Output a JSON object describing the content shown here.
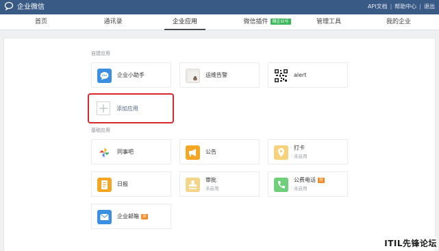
{
  "topbar": {
    "logo_text": "企业微信",
    "links": [
      "API文档",
      "帮助中心",
      "退出"
    ],
    "separator": "|",
    "bg_color": "#3a5a86"
  },
  "nav": {
    "items": [
      {
        "label": "首页"
      },
      {
        "label": "通讯录"
      },
      {
        "label": "企业应用",
        "active": true
      },
      {
        "label": "微信插件",
        "badge": "随企业号"
      },
      {
        "label": "管理工具"
      },
      {
        "label": "我的企业"
      }
    ]
  },
  "sections": {
    "custom_label": "自建应用",
    "basic_label": "基础应用"
  },
  "custom_apps": [
    {
      "name": "企业小助手",
      "icon": "chat-bubble-icon"
    },
    {
      "name": "运维告警",
      "icon": "photo-thumbnail-icon"
    },
    {
      "name": "alert",
      "icon": "qr-code-icon"
    }
  ],
  "add_app": {
    "label": "添加应用",
    "icon": "plus-icon"
  },
  "basic_apps": [
    {
      "name": "同事吧",
      "icon": "pinwheel-icon"
    },
    {
      "name": "公告",
      "icon": "megaphone-icon"
    },
    {
      "name": "打卡",
      "status": "未启用",
      "icon": "location-pin-icon"
    },
    {
      "name": "日报",
      "icon": "report-icon"
    },
    {
      "name": "审批",
      "status": "未启用",
      "icon": "stamp-icon"
    },
    {
      "name": "公费电话",
      "status": "未启用",
      "badge": "测",
      "icon": "phone-icon"
    },
    {
      "name": "企业邮箱",
      "badge": "测",
      "icon": "mail-icon"
    }
  ],
  "watermark": "ITIL先锋论坛",
  "colors": {
    "accent_red": "#d9262a",
    "green_badge": "#3db65a",
    "orange_badge": "#f08a24"
  }
}
